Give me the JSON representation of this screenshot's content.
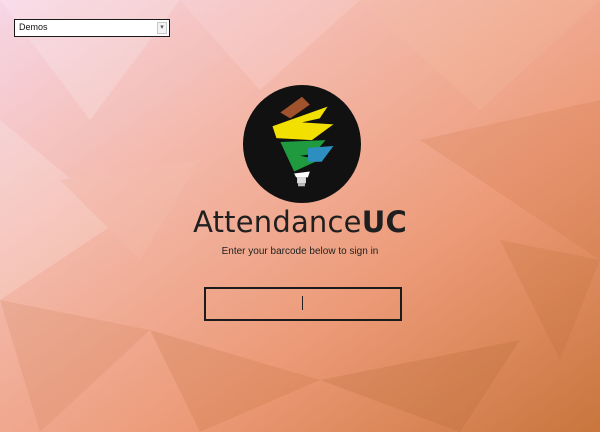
{
  "app": {
    "brand_light": "Attendance",
    "brand_bold": "UC"
  },
  "selector": {
    "value": "Demos"
  },
  "signin": {
    "instructions": "Enter your barcode below to sign in",
    "barcode_value": ""
  },
  "colors": {
    "logo_background": "#111111",
    "logo_brown": "#a0522d",
    "logo_yellow": "#f2e000",
    "logo_green": "#1f9a3e",
    "logo_blue": "#2d8fc0",
    "text": "#1f1f1f"
  },
  "icons": {
    "logo": "torch-lamp-logo",
    "dropdown": "chevron-down-icon"
  }
}
